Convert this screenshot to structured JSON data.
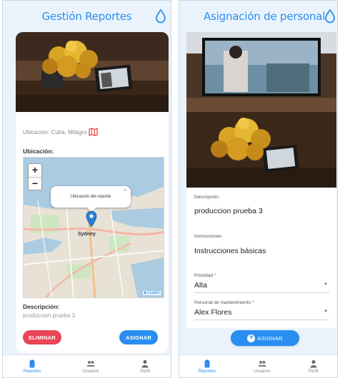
{
  "left": {
    "title": "Gestión Reportes",
    "location_line": "Ubicacion: Cuba, Milagro",
    "ubicacion_label": "Ubicación:",
    "map": {
      "zoom_in": "+",
      "zoom_out": "−",
      "popup_text": "Ubicación del reporte",
      "popup_close": "×",
      "city_label": "Sydney",
      "attribution": "■ Leaflet"
    },
    "descripcion_label": "Descripción:",
    "descripcion_value": "produccion prueba 3",
    "delete_button": "ELIMINAR",
    "assign_button": "ASIGNAR"
  },
  "right": {
    "title": "Asignación de personal",
    "fields": {
      "descripcion_label": "Descripción",
      "descripcion_value": "produccion prueba 3",
      "instrucciones_label": "Instrucciones",
      "instrucciones_value": "Instrucciones básicas",
      "prioridad_label": "Prioridad",
      "prioridad_value": "Alta",
      "personal_label": "Personal de mantenimiento",
      "personal_value": "Alex Flores",
      "required_mark": "*"
    },
    "assign_button": "ASIGNAR"
  },
  "nav": {
    "reportes": "Reportes",
    "usuarios": "Usuarios",
    "perfil": "Perfil"
  },
  "colors": {
    "accent": "#2a8ef0",
    "danger": "#ea4455",
    "background": "#eaf3fc"
  }
}
